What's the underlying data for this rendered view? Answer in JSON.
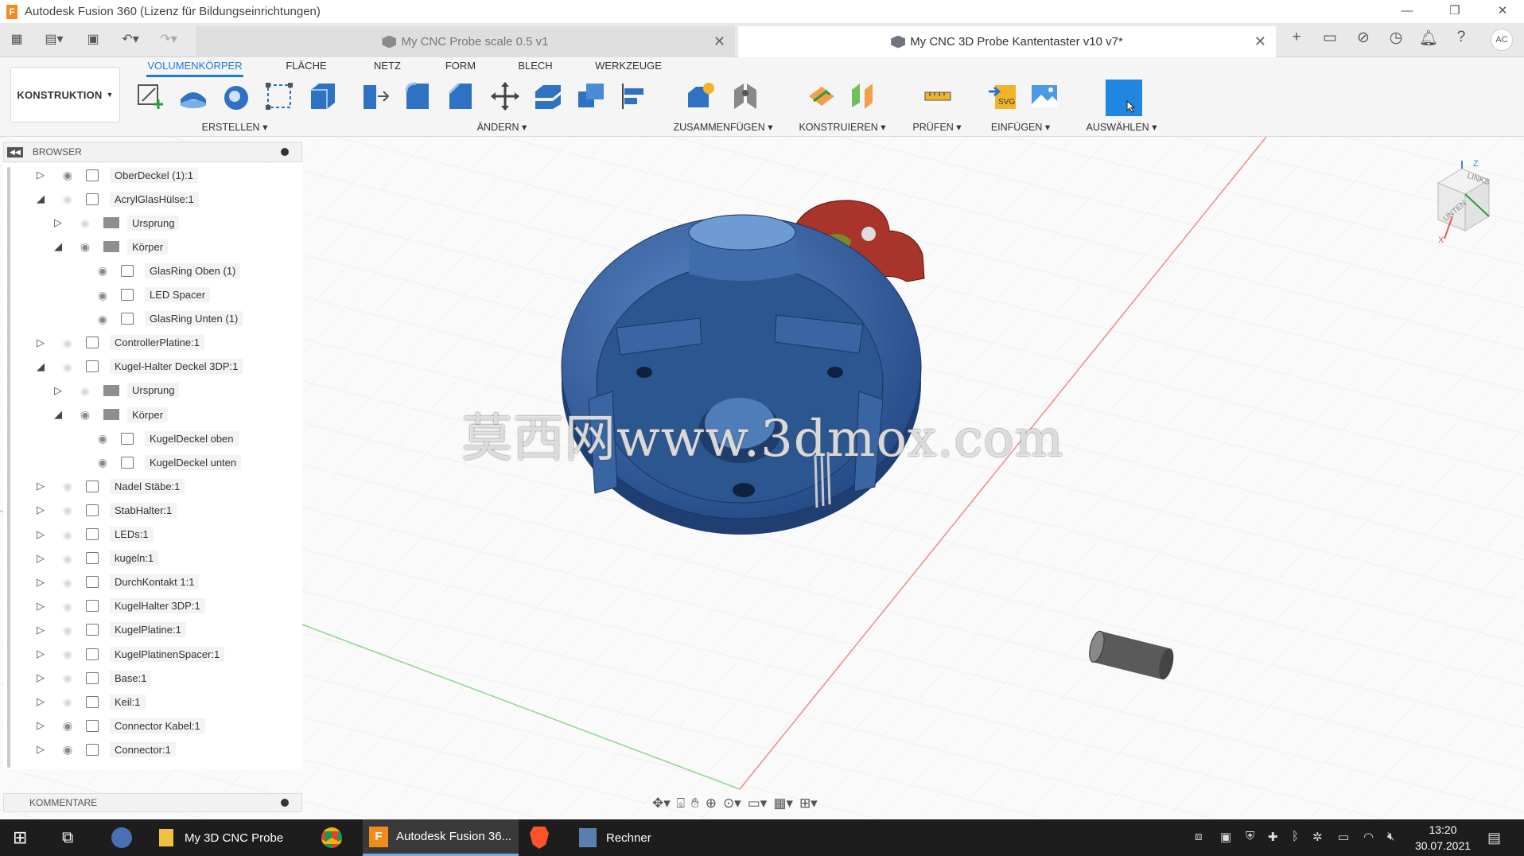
{
  "window": {
    "title": "Autodesk Fusion 360 (Lizenz für Bildungseinrichtungen)",
    "app_icon_letter": "F",
    "controls": [
      "minimize-icon",
      "restore-icon",
      "close-icon"
    ]
  },
  "tabs": [
    {
      "label": "My CNC Probe scale 0.5 v1",
      "active": false
    },
    {
      "label": "My CNC 3D Probe Kantentaster v10 v7*",
      "active": true
    }
  ],
  "user_initials": "AC",
  "workspace": {
    "label": "KONSTRUKTION"
  },
  "categories": [
    "VOLUMENKÖRPER",
    "FLÄCHE",
    "NETZ",
    "FORM",
    "BLECH",
    "WERKZEUGE"
  ],
  "groups": [
    "ERSTELLEN",
    "ÄNDERN",
    "ZUSAMMENFÜGEN",
    "KONSTRUIEREN",
    "PRÜFEN",
    "EINFÜGEN",
    "AUSWÄHLEN"
  ],
  "browser": {
    "title": "BROWSER",
    "items": [
      {
        "label": "OberDeckel (1):1",
        "level": 0,
        "expanded": false,
        "visible": true,
        "kind": "component"
      },
      {
        "label": "AcrylGlasHülse:1",
        "level": 0,
        "expanded": true,
        "visible": false,
        "kind": "component"
      },
      {
        "label": "Ursprung",
        "level": 1,
        "expanded": false,
        "visible": false,
        "kind": "folder"
      },
      {
        "label": "Körper",
        "level": 1,
        "expanded": true,
        "visible": true,
        "kind": "folder"
      },
      {
        "label": "GlasRing Oben (1)",
        "level": 2,
        "expanded": null,
        "visible": true,
        "kind": "body"
      },
      {
        "label": "LED Spacer",
        "level": 2,
        "expanded": null,
        "visible": true,
        "kind": "body"
      },
      {
        "label": "GlasRing Unten (1)",
        "level": 2,
        "expanded": null,
        "visible": true,
        "kind": "body"
      },
      {
        "label": "ControllerPlatine:1",
        "level": 0,
        "expanded": false,
        "visible": false,
        "kind": "component"
      },
      {
        "label": "Kugel-Halter Deckel 3DP:1",
        "level": 0,
        "expanded": true,
        "visible": false,
        "kind": "component"
      },
      {
        "label": "Ursprung",
        "level": 1,
        "expanded": false,
        "visible": false,
        "kind": "folder"
      },
      {
        "label": "Körper",
        "level": 1,
        "expanded": true,
        "visible": true,
        "kind": "folder"
      },
      {
        "label": "KugelDeckel oben",
        "level": 2,
        "expanded": null,
        "visible": true,
        "kind": "body"
      },
      {
        "label": "KugelDeckel unten",
        "level": 2,
        "expanded": null,
        "visible": true,
        "kind": "body"
      },
      {
        "label": "Nadel Stäbe:1",
        "level": 0,
        "expanded": false,
        "visible": false,
        "kind": "component"
      },
      {
        "label": "StabHalter:1",
        "level": 0,
        "expanded": false,
        "visible": false,
        "kind": "component"
      },
      {
        "label": "LEDs:1",
        "level": 0,
        "expanded": false,
        "visible": false,
        "kind": "component"
      },
      {
        "label": "kugeln:1",
        "level": 0,
        "expanded": false,
        "visible": false,
        "kind": "component"
      },
      {
        "label": "DurchKontakt 1:1",
        "level": 0,
        "expanded": false,
        "visible": false,
        "kind": "component"
      },
      {
        "label": "KugelHalter 3DP:1",
        "level": 0,
        "expanded": false,
        "visible": false,
        "kind": "component"
      },
      {
        "label": "KugelPlatine:1",
        "level": 0,
        "expanded": false,
        "visible": false,
        "kind": "component"
      },
      {
        "label": "KugelPlatinenSpacer:1",
        "level": 0,
        "expanded": false,
        "visible": false,
        "kind": "component"
      },
      {
        "label": "Base:1",
        "level": 0,
        "expanded": false,
        "visible": false,
        "kind": "component"
      },
      {
        "label": "Keil:1",
        "level": 0,
        "expanded": false,
        "visible": false,
        "kind": "component"
      },
      {
        "label": "Connector Kabel:1",
        "level": 0,
        "expanded": false,
        "visible": true,
        "kind": "component"
      },
      {
        "label": "Connector:1",
        "level": 0,
        "expanded": false,
        "visible": true,
        "kind": "component"
      }
    ]
  },
  "comments_title": "KOMMENTARE",
  "viewcube": {
    "faces": [
      "LINKS",
      "UNTEN"
    ],
    "axes": [
      "Z",
      "X"
    ]
  },
  "watermark": "莫西网www.3dmox.com",
  "taskbar": {
    "apps": [
      "My 3D CNC Probe",
      "Autodesk Fusion 36...",
      "Rechner"
    ],
    "time": "13:20",
    "date": "30.07.2021"
  },
  "colors": {
    "accent": "#1d7ad6",
    "part_blue": "#3d66a6",
    "part_red": "#a8342a",
    "taskbar": "#1d1d1d"
  }
}
